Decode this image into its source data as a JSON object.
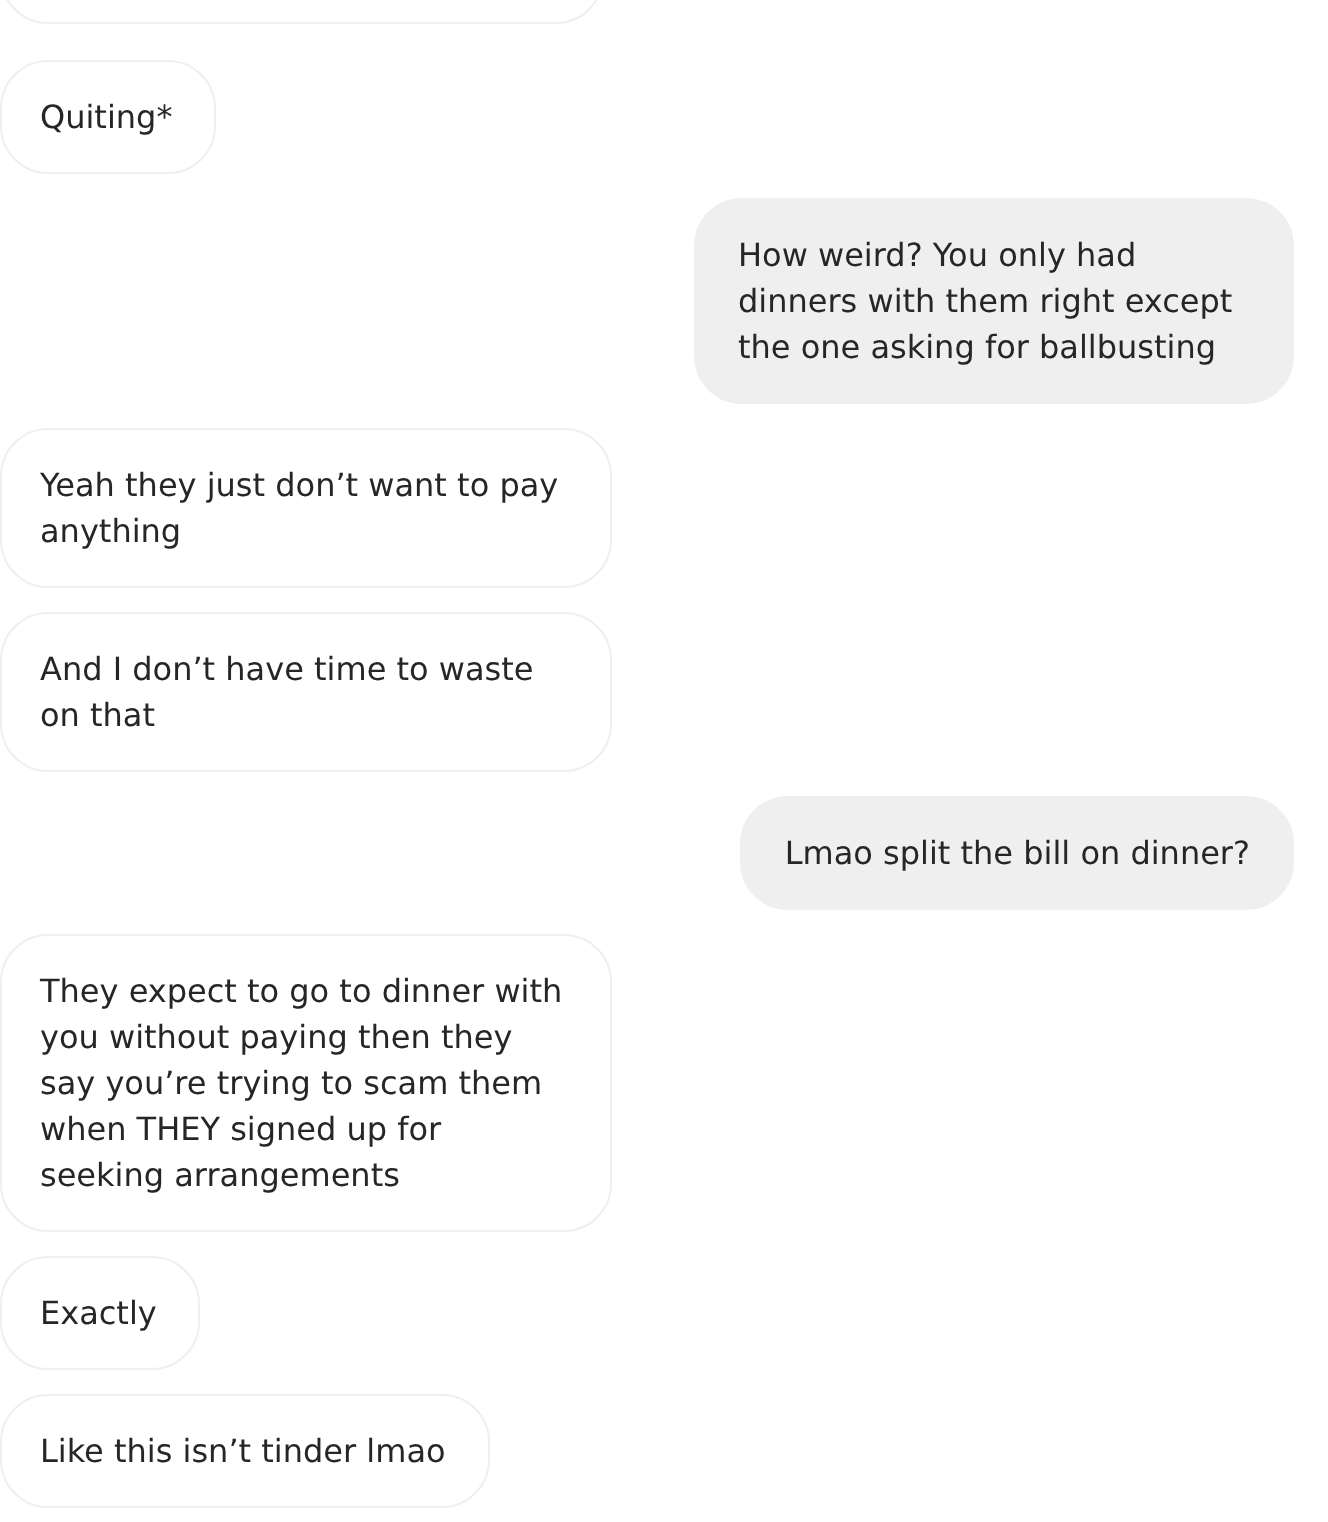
{
  "conversation": {
    "clipped_bubble_above": true,
    "messages": [
      {
        "kind": "received",
        "text": "Quiting*"
      },
      {
        "kind": "sent",
        "text": "How weird? You only had dinners with them right except the one asking for ballbusting"
      },
      {
        "kind": "received",
        "text": "Yeah they just don’t want to pay anything"
      },
      {
        "kind": "received",
        "text": "And I don’t have time to waste on that"
      },
      {
        "kind": "sent",
        "text": "Lmao split the bill on dinner?"
      },
      {
        "kind": "received",
        "text": "They expect to go to dinner with you without paying then they say you’re trying to scam them when THEY signed up for seeking arrangements"
      },
      {
        "kind": "received",
        "text": "Exactly"
      },
      {
        "kind": "received",
        "text": "Like this isn’t tinder lmao"
      }
    ]
  }
}
